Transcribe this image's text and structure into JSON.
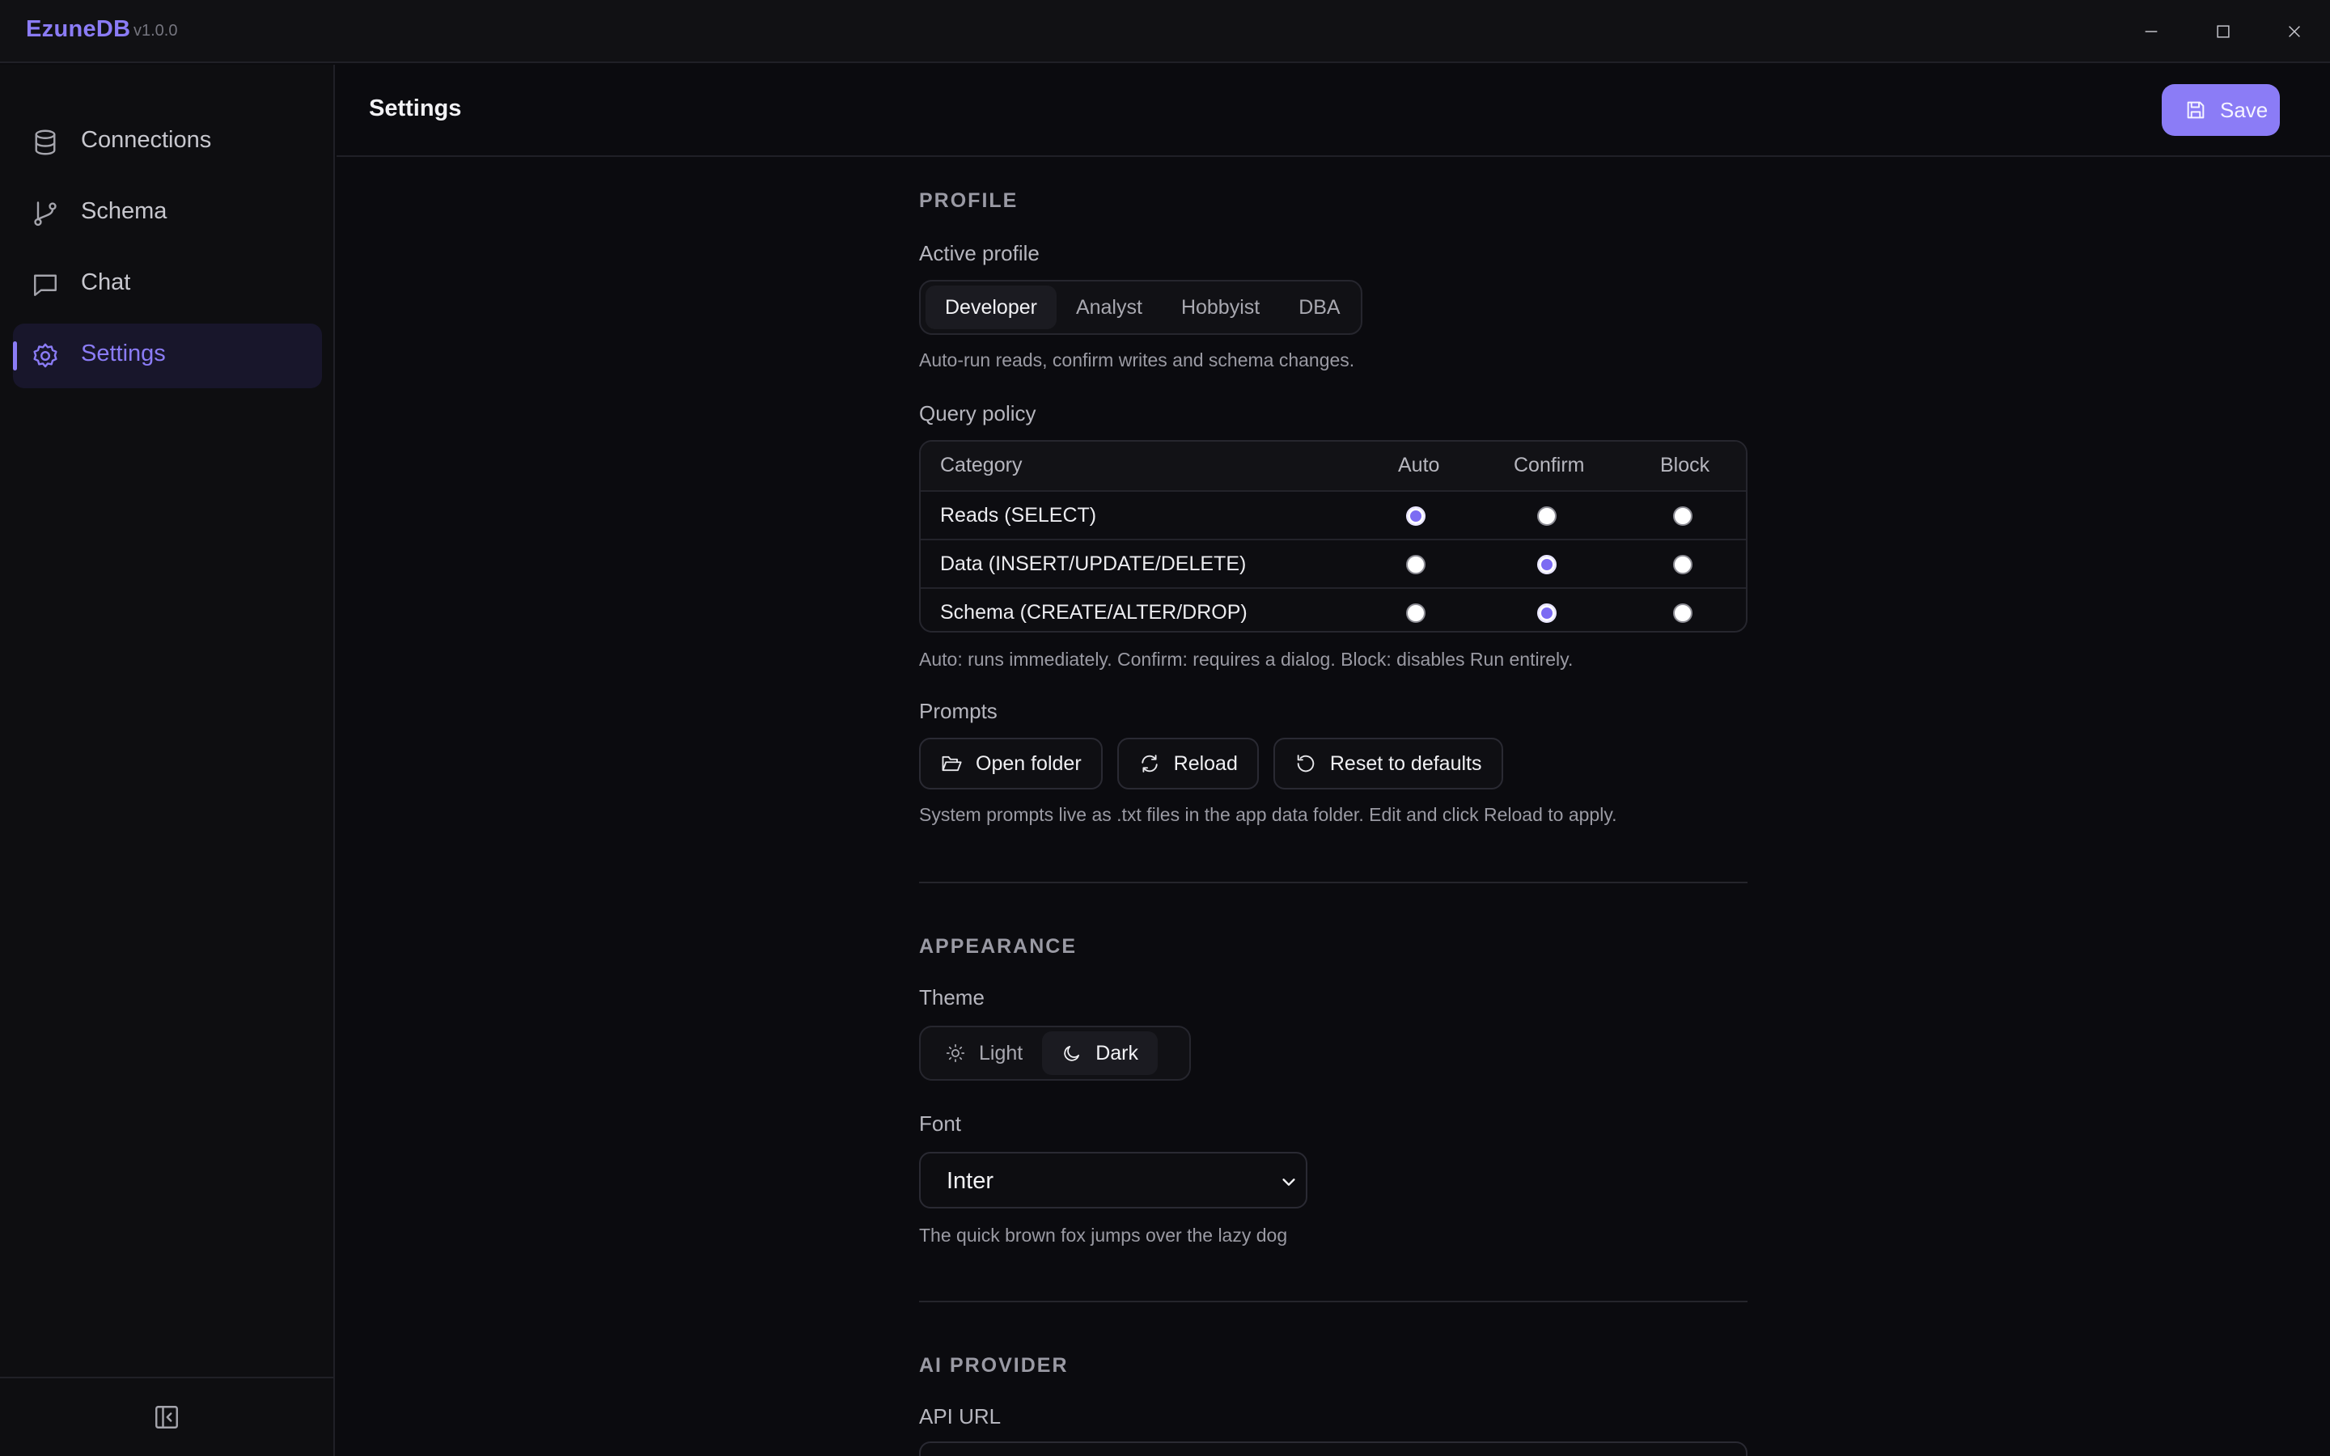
{
  "app": {
    "name": "EzuneDB",
    "version": "v1.0.0"
  },
  "window_controls": [
    "minimize-icon",
    "maximize-icon",
    "close-icon"
  ],
  "colors": {
    "accent": "#8b7cf6",
    "background": "#0b0b0f",
    "sidebar": "#0e0e11",
    "active_nav": "#18162b"
  },
  "sidebar": {
    "items": [
      {
        "label": "Connections",
        "icon": "database-icon",
        "active": false
      },
      {
        "label": "Schema",
        "icon": "git-branch-icon",
        "active": false
      },
      {
        "label": "Chat",
        "icon": "message-square-icon",
        "active": false
      },
      {
        "label": "Settings",
        "icon": "gear-icon",
        "active": true
      }
    ],
    "collapse_icon": "panel-left-collapse-icon"
  },
  "header": {
    "title": "Settings",
    "save_label": "Save"
  },
  "profile": {
    "heading": "PROFILE",
    "active_profile_label": "Active profile",
    "profiles": [
      "Developer",
      "Analyst",
      "Hobbyist",
      "DBA"
    ],
    "selected_profile": "Developer",
    "profile_help": "Auto-run reads, confirm writes and schema changes.",
    "query_policy_label": "Query policy",
    "policy_columns": [
      "Category",
      "Auto",
      "Confirm",
      "Block"
    ],
    "policy_rows": [
      {
        "category": "Reads (SELECT)",
        "selected": "Auto"
      },
      {
        "category": "Data (INSERT/UPDATE/DELETE)",
        "selected": "Confirm"
      },
      {
        "category": "Schema (CREATE/ALTER/DROP)",
        "selected": "Confirm"
      }
    ],
    "policy_help": "Auto: runs immediately. Confirm: requires a dialog. Block: disables Run entirely.",
    "prompts_label": "Prompts",
    "prompt_buttons": [
      {
        "label": "Open folder",
        "icon": "folder-open-icon"
      },
      {
        "label": "Reload",
        "icon": "refresh-icon"
      },
      {
        "label": "Reset to defaults",
        "icon": "rotate-ccw-icon"
      }
    ],
    "prompts_help": "System prompts live as .txt files in the app data folder. Edit and click Reload to apply."
  },
  "appearance": {
    "heading": "APPEARANCE",
    "theme_label": "Theme",
    "themes": [
      {
        "label": "Light",
        "icon": "sun-icon"
      },
      {
        "label": "Dark",
        "icon": "moon-icon"
      }
    ],
    "selected_theme": "Dark",
    "font_label": "Font",
    "font_value": "Inter",
    "font_preview": "The quick brown fox jumps over the lazy dog"
  },
  "ai_provider": {
    "heading": "AI PROVIDER",
    "api_url_label": "API URL"
  }
}
